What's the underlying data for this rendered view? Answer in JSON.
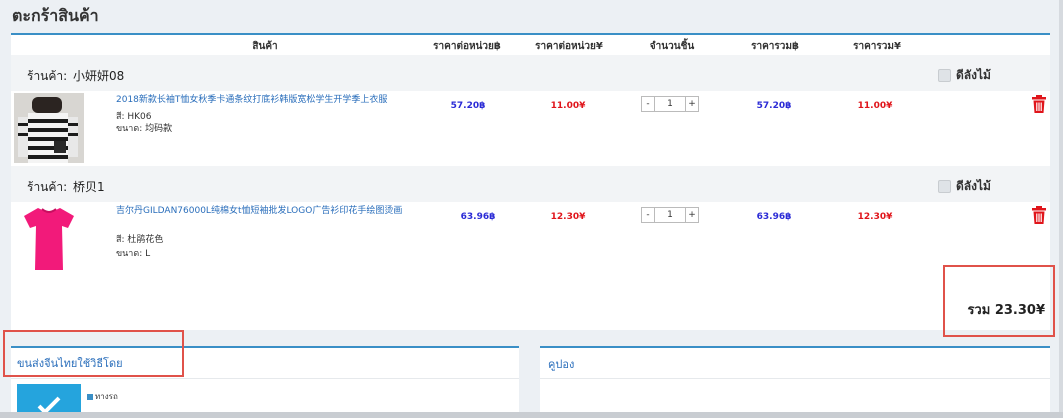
{
  "page": {
    "title": "ตะกร้าสินค้า"
  },
  "table_headers": {
    "product": "สินค้า",
    "unit_price_thb": "ราคาต่อหน่วย฿",
    "unit_price_cny": "ราคาต่อหน่วย¥",
    "quantity": "จำนวนชิ้น",
    "total_thb": "ราคารวม฿",
    "total_cny": "ราคารวม¥"
  },
  "shops": [
    {
      "label": "ร้านค้า:",
      "name": "小妍妍08",
      "favorite_label": "ดีลังไม้",
      "item": {
        "name": "2018新款长袖T恤女秋季卡通条纹打底衫韩版宽松学生开学季上衣服",
        "color": "สี: HK06",
        "size": "ขนาด: 均码款",
        "unit_price_thb": "57.20฿",
        "unit_price_cny": "11.00¥",
        "quantity": "1",
        "total_thb": "57.20฿",
        "total_cny": "11.00¥",
        "thumbnail": "striped-long-sleeve-shirt"
      }
    },
    {
      "label": "ร้านค้า:",
      "name": "桥贝1",
      "favorite_label": "ดีลังไม้",
      "item": {
        "name": "吉尔丹GILDAN76000L纯棉女t恤短袖批发LOGO广告衫印花手绘图烫画",
        "color": "สี: 杜鹃花色",
        "size": "ขนาด: L",
        "unit_price_thb": "63.96฿",
        "unit_price_cny": "12.30¥",
        "quantity": "1",
        "total_thb": "63.96฿",
        "total_cny": "12.30¥",
        "thumbnail": "pink-tshirt"
      }
    }
  ],
  "qty_controls": {
    "minus": "-",
    "plus": "+"
  },
  "total": {
    "text": "รวม 23.30¥"
  },
  "shipping": {
    "title": "ขนส่งจีนไทยใช้วิธีโดย",
    "option_label": "ทางรถ"
  },
  "coupon": {
    "title": "คูปอง"
  },
  "colors": {
    "accent": "#3a8fc6",
    "thb_price": "#2b2bd6",
    "cny_price": "#e0151b",
    "highlight": "#e0524a",
    "trash": "#e0151b"
  },
  "icons": {
    "delete": "trash-icon",
    "checkbox": "checkbox-icon"
  }
}
